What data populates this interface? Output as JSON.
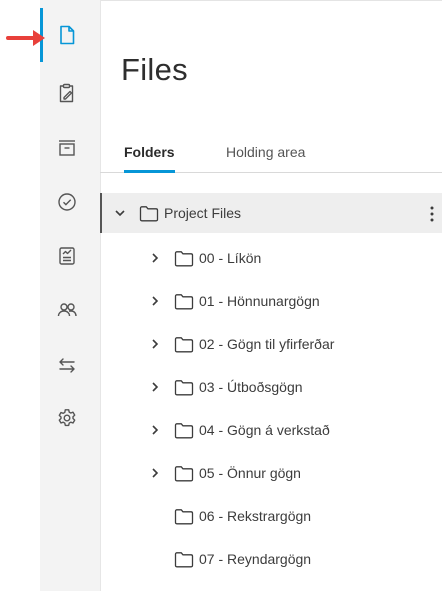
{
  "page": {
    "title": "Files"
  },
  "tabs": {
    "folders": "Folders",
    "holding_area": "Holding area",
    "active": "Folders"
  },
  "sidebar": {
    "items": [
      {
        "icon": "document-icon",
        "active": true
      },
      {
        "icon": "clipboard-edit-icon"
      },
      {
        "icon": "archive-icon"
      },
      {
        "icon": "check-circle-icon"
      },
      {
        "icon": "report-icon"
      },
      {
        "icon": "people-icon"
      },
      {
        "icon": "transfer-arrows-icon"
      },
      {
        "icon": "gear-icon"
      }
    ]
  },
  "tree": {
    "root": {
      "label": "Project Files",
      "expanded": true
    },
    "children": [
      {
        "label": "00 - Líkön",
        "has_children": true
      },
      {
        "label": "01 - Hönnunargögn",
        "has_children": true
      },
      {
        "label": "02 - Gögn til yfirferðar",
        "has_children": true
      },
      {
        "label": "03 - Útboðsgögn",
        "has_children": true
      },
      {
        "label": "04 - Gögn á verkstað",
        "has_children": true
      },
      {
        "label": "05 - Önnur gögn",
        "has_children": true
      },
      {
        "label": "06 - Rekstrargögn",
        "has_children": false
      },
      {
        "label": "07 - Reyndargögn",
        "has_children": false
      }
    ]
  },
  "colors": {
    "accent": "#0696d7",
    "pointer_arrow": "#e8403a",
    "sidebar_bg": "#f3f3f3"
  }
}
